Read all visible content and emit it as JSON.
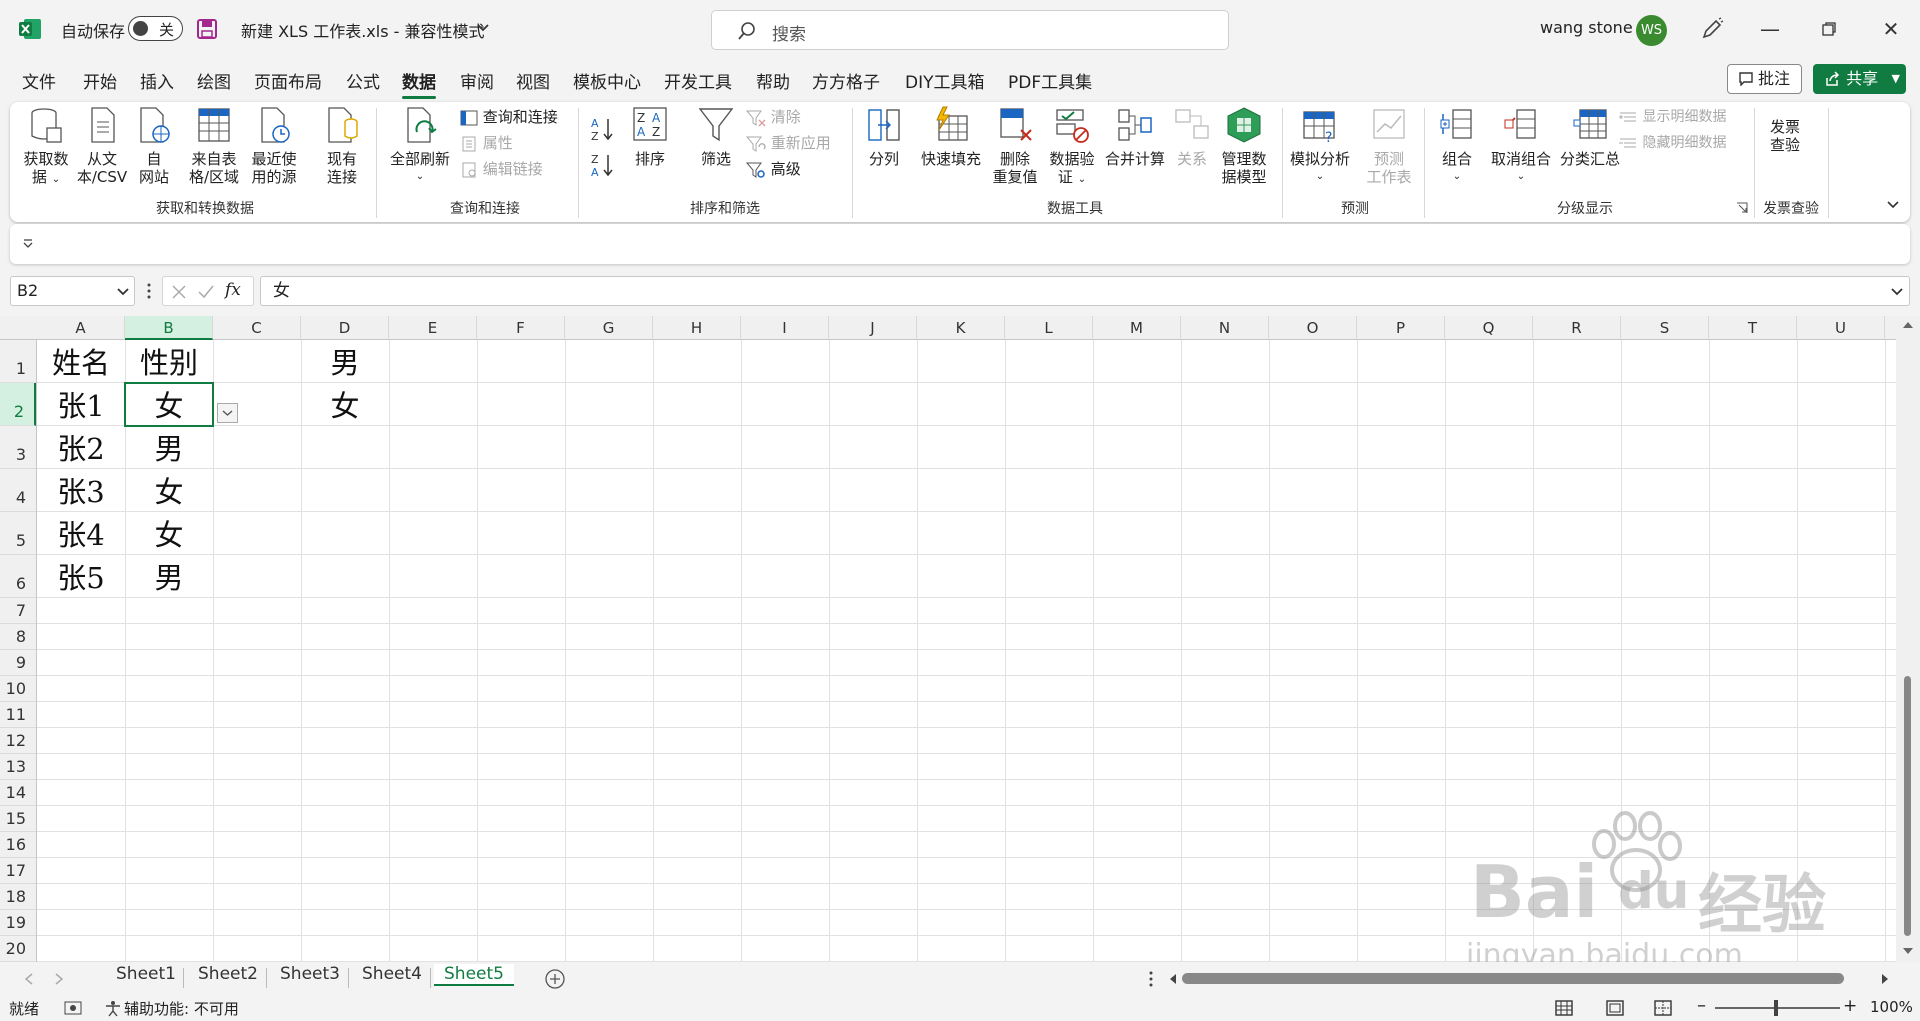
{
  "titlebar": {
    "autosave_label": "自动保存",
    "autosave_state": "关",
    "file_title": "新建 XLS 工作表.xls  -  兼容性模式",
    "search_placeholder": "搜索",
    "user_name": "wang stone",
    "user_initials": "WS"
  },
  "menu": {
    "tabs": [
      "文件",
      "开始",
      "插入",
      "绘图",
      "页面布局",
      "公式",
      "数据",
      "审阅",
      "视图",
      "模板中心",
      "开发工具",
      "帮助",
      "方方格子",
      "DIY工具箱",
      "PDF工具集"
    ],
    "active": "数据",
    "comment_label": "批注",
    "share_label": "共享"
  },
  "ribbon": {
    "groups": {
      "get_data": "获取和转换数据",
      "queries": "查询和连接",
      "sort_filter": "排序和筛选",
      "data_tools": "数据工具",
      "forecast": "预测",
      "outline": "分级显示",
      "invoice": "发票查验"
    },
    "buttons": {
      "get_data_1": "获取数",
      "get_data_2": "据",
      "from_csv_1": "从文",
      "from_csv_2": "本/CSV",
      "from_web_1": "自",
      "from_web_2": "网站",
      "from_table_1": "来自表",
      "from_table_2": "格/区域",
      "recent_1": "最近使",
      "recent_2": "用的源",
      "existing_1": "现有",
      "existing_2": "连接",
      "refresh_all": "全部刷新",
      "queries_connections": "查询和连接",
      "properties": "属性",
      "edit_links": "编辑链接",
      "sort": "排序",
      "filter": "筛选",
      "clear": "清除",
      "reapply": "重新应用",
      "advanced": "高级",
      "text_to_columns": "分列",
      "flash_fill": "快速填充",
      "remove_dup_1": "删除",
      "remove_dup_2": "重复值",
      "validation_1": "数据验",
      "validation_2": "证",
      "consolidate": "合并计算",
      "relationships": "关系",
      "data_model_1": "管理数",
      "data_model_2": "据模型",
      "whatif": "模拟分析",
      "forecast_sheet_1": "预测",
      "forecast_sheet_2": "工作表",
      "group": "组合",
      "ungroup": "取消组合",
      "subtotal": "分类汇总",
      "show_detail": "显示明细数据",
      "hide_detail": "隐藏明细数据",
      "invoice_1": "发票",
      "invoice_2": "查验"
    }
  },
  "formula_bar": {
    "name_box": "B2",
    "fx": "fx",
    "formula": "女"
  },
  "sheet": {
    "columns": [
      "A",
      "B",
      "C",
      "D",
      "E",
      "F",
      "G",
      "H",
      "I",
      "J",
      "K",
      "L",
      "M",
      "N",
      "O",
      "P",
      "Q",
      "R",
      "S",
      "T",
      "U"
    ],
    "rows": [
      "1",
      "2",
      "3",
      "4",
      "5",
      "6",
      "7",
      "8",
      "9",
      "10",
      "11",
      "12",
      "13",
      "14",
      "15",
      "16",
      "17",
      "18",
      "19",
      "20"
    ],
    "selected_cell": "B2",
    "cells": {
      "A1": "姓名",
      "B1": "性别",
      "D1": "男",
      "A2": "张1",
      "B2": "女",
      "D2": "女",
      "A3": "张2",
      "B3": "男",
      "A4": "张3",
      "B4": "女",
      "A5": "张4",
      "B5": "女",
      "A6": "张5",
      "B6": "男"
    }
  },
  "sheet_tabs": {
    "tabs": [
      "Sheet1",
      "Sheet2",
      "Sheet3",
      "Sheet4",
      "Sheet5"
    ],
    "active": "Sheet5"
  },
  "status": {
    "ready": "就绪",
    "accessibility": "辅助功能: 不可用",
    "zoom": "100%"
  },
  "watermark": {
    "line1": "Bai",
    "line1b": "du",
    "line1c": "经验",
    "line2": "jingyan.baidu.com"
  },
  "colors": {
    "accent": "#107c41",
    "selected_header": "#d3f0e0"
  }
}
